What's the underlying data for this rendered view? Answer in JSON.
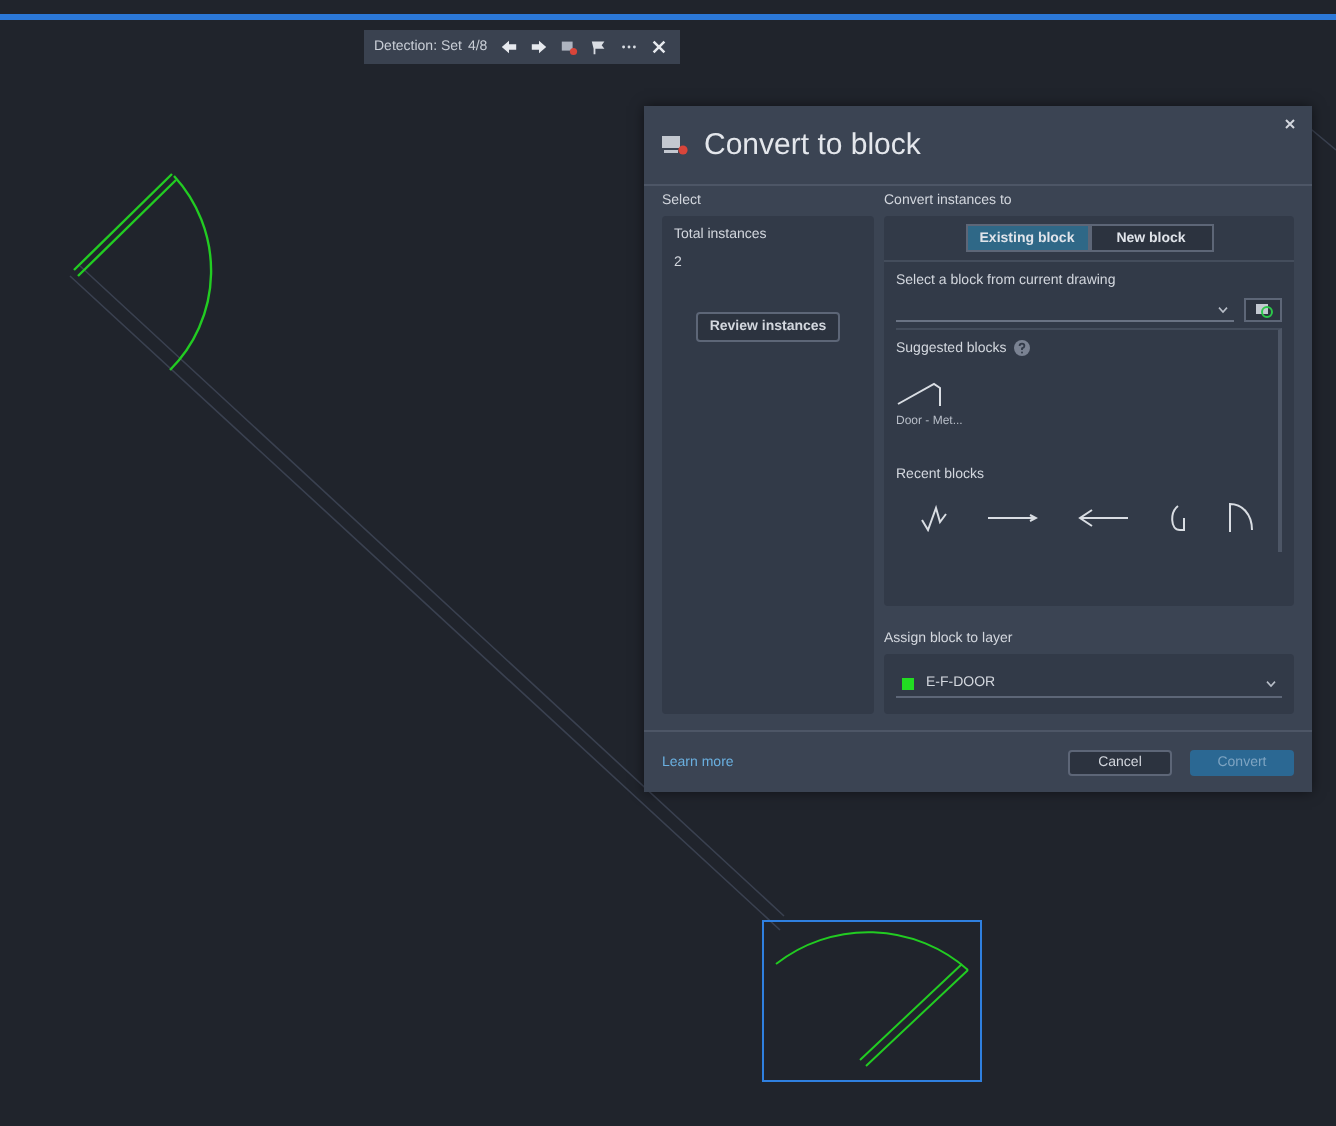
{
  "toolbar": {
    "label": "Detection: Set",
    "counter": "4/8"
  },
  "dialog": {
    "title": "Convert to block",
    "select": {
      "heading": "Select",
      "total_label": "Total instances",
      "total_value": "2",
      "review_button": "Review instances"
    },
    "convert": {
      "heading": "Convert instances to",
      "modes": [
        {
          "label": "Existing block",
          "selected": true
        },
        {
          "label": "New block",
          "selected": false
        }
      ],
      "block_select_label": "Select a block from current drawing",
      "suggested_heading": "Suggested blocks",
      "suggested": [
        {
          "name": "Door - Met..."
        }
      ],
      "recent_heading": "Recent blocks",
      "recent": [
        {
          "kind": "zigzag"
        },
        {
          "kind": "arrow-right"
        },
        {
          "kind": "arrow-left"
        },
        {
          "kind": "hook"
        },
        {
          "kind": "arch"
        }
      ]
    },
    "layer": {
      "heading": "Assign block to layer",
      "name": "E-F-DOOR",
      "color": "#22dd22"
    },
    "footer": {
      "link": "Learn more",
      "cancel": "Cancel",
      "convert": {
        "label": "Convert",
        "disabled": true
      }
    }
  }
}
